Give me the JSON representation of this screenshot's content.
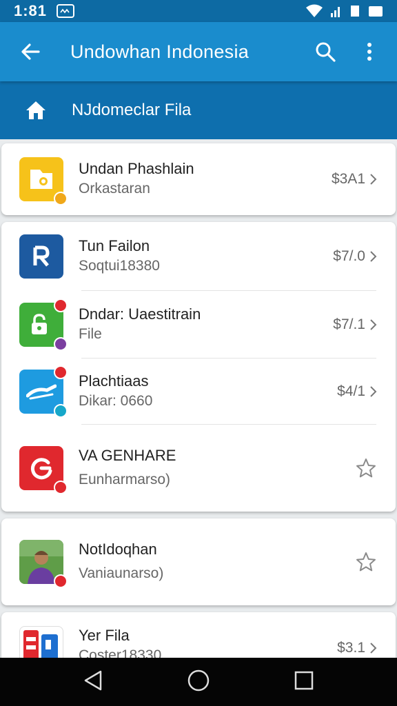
{
  "status_bar": {
    "time": "1:81",
    "icons": [
      "notification-icon",
      "wifi-icon",
      "signal-icon",
      "sim-icon",
      "battery-icon"
    ]
  },
  "app_bar": {
    "title": "Undowhan Indonesia",
    "icons": [
      "back-arrow-icon",
      "search-icon",
      "more-vert-icon"
    ]
  },
  "sub_header": {
    "title": "NJdomeclar Fila",
    "icon": "home-icon"
  },
  "items": [
    {
      "title": "Undan Phashlain",
      "subtitle": "Orkastaran",
      "price": "$3A1",
      "icon_color": "#f6c21a"
    },
    {
      "title": "Tun Failon",
      "subtitle": "Soqtui18380",
      "price": "$7/.0",
      "icon_color": "#1d5aa0"
    },
    {
      "title": "Dndar: Uaestitrain",
      "subtitle": "File",
      "price": "$7/.1",
      "icon_color": "#3fae3a"
    },
    {
      "title": "Plachtiaas",
      "subtitle": "Dikar: 0660",
      "price": "$4/1",
      "icon_color": "#1e9be0"
    },
    {
      "title": "VA GENHARE",
      "subtitle": "Eunharmarso)",
      "icon_color": "#e0282e"
    },
    {
      "title": "NotIdoqhan",
      "subtitle": "Vaniaunarso)",
      "icon_color": "#4a8a3a"
    },
    {
      "title": "Yer Fila",
      "subtitle": "Coster18330",
      "price": "$3.1",
      "icon_color": "#e0282e"
    }
  ],
  "nav_bar": {
    "icons": [
      "back-triangle-icon",
      "home-circle-icon",
      "recents-square-icon"
    ]
  },
  "colors": {
    "status_bar": "#0d6aa3",
    "app_bar": "#1a8ccd",
    "sub_header": "#0e6fae",
    "nav_bar": "#050505"
  }
}
